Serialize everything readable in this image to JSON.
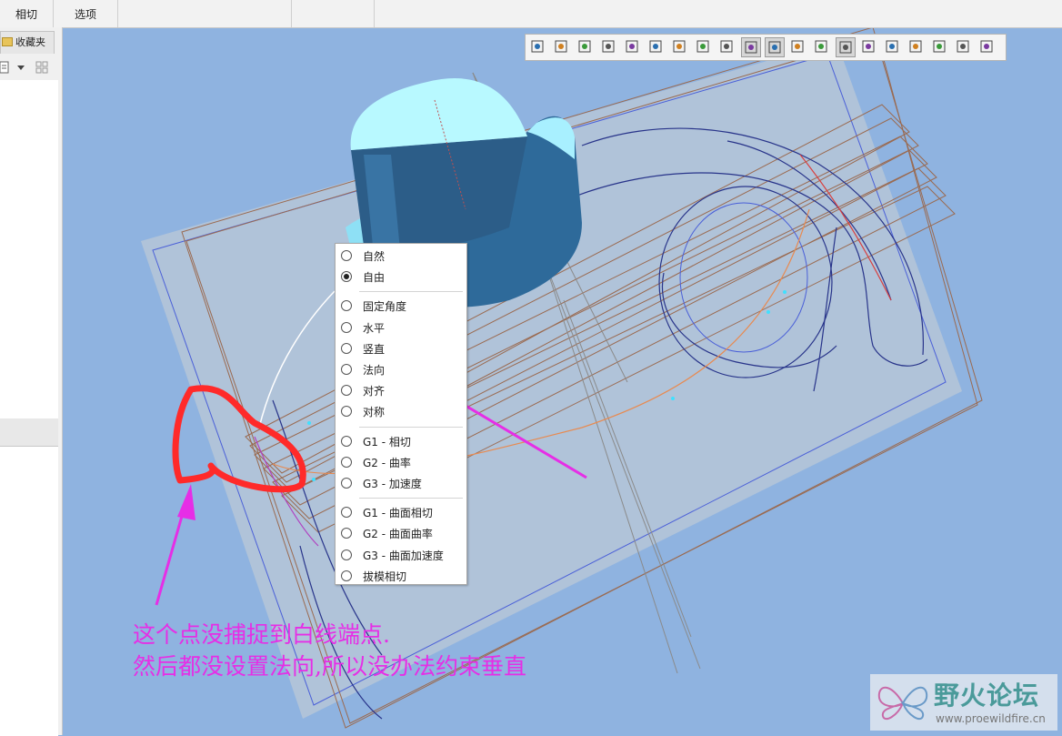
{
  "tabs": [
    "相切",
    "选项"
  ],
  "left_panel": {
    "favorites_tab": "收藏夹"
  },
  "toolbar": {
    "buttons": [
      "refit-icon",
      "zoom-in-icon",
      "zoom-out-icon",
      "repaint-icon",
      "display-style-icon",
      "saved-views-icon",
      "view-manager-icon",
      "spin-center-icon",
      "datum-display-icon",
      "plane-display-icon",
      "axis-display-icon",
      "point-display-icon",
      "csys-display-icon",
      "annotation-display-icon",
      "curve-display-icon",
      "curvature-icon",
      "section-icon",
      "geometry-icon",
      "grid-icon",
      "mirror-icon"
    ],
    "active_buttons": [
      "plane-display-icon",
      "axis-display-icon",
      "annotation-display-icon"
    ]
  },
  "context_menu": {
    "groups": [
      [
        {
          "label": "自然",
          "selected": false
        },
        {
          "label": "自由",
          "selected": true
        }
      ],
      [
        {
          "label": "固定角度",
          "selected": false
        },
        {
          "label": "水平",
          "selected": false
        },
        {
          "label": "竖直",
          "selected": false
        },
        {
          "label": "法向",
          "selected": false
        },
        {
          "label": "对齐",
          "selected": false
        },
        {
          "label": "对称",
          "selected": false
        }
      ],
      [
        {
          "label": "G1 - 相切",
          "selected": false
        },
        {
          "label": "G2 - 曲率",
          "selected": false
        },
        {
          "label": "G3 - 加速度",
          "selected": false
        }
      ],
      [
        {
          "label": "G1 - 曲面相切",
          "selected": false
        },
        {
          "label": "G2 - 曲面曲率",
          "selected": false
        },
        {
          "label": "G3 - 曲面加速度",
          "selected": false
        },
        {
          "label": "拔模相切",
          "selected": false
        }
      ]
    ]
  },
  "annotation": {
    "line1": "这个点没捕捉到白线端点.",
    "line2": "然后都没设置法向,所以没办法约束垂直",
    "color": "#e62ee6"
  },
  "watermark": {
    "title": "野火论坛",
    "url": "www.proewildfire.cn"
  },
  "colors": {
    "viewport_bg": "#8fb3e0",
    "plane": "#b3c4d8",
    "annotation": "#e62ee6"
  }
}
